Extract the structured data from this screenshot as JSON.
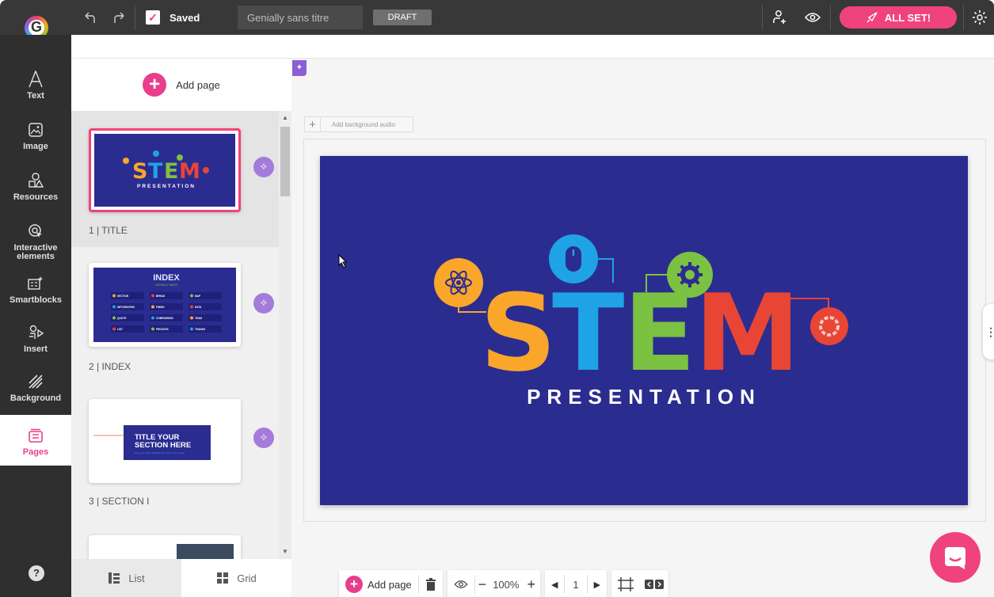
{
  "topbar": {
    "logo_letter": "G",
    "saved_label": "Saved",
    "title_value": "Genially sans titre",
    "draft_label": "DRAFT",
    "all_set_label": "ALL SET!"
  },
  "tools": [
    {
      "label": "Text"
    },
    {
      "label": "Image"
    },
    {
      "label": "Resources"
    },
    {
      "label": "Interactive elements"
    },
    {
      "label": "Smartblocks"
    },
    {
      "label": "Insert"
    },
    {
      "label": "Background"
    },
    {
      "label": "Pages"
    }
  ],
  "pages_panel": {
    "add_page_label": "Add page",
    "pages": [
      {
        "label": "1 | TITLE"
      },
      {
        "label": "2 | INDEX"
      },
      {
        "label": "3 | SECTION I"
      }
    ],
    "list_label": "List",
    "grid_label": "Grid"
  },
  "thumb1": {
    "stem": "STEM",
    "presentation": "PRESENTATION"
  },
  "thumb2": {
    "title": "INDEX",
    "subtitle": "GENIALLY MARS",
    "items": [
      "SECTION",
      "BREAK",
      "MAP",
      "INFOGRAPHIC",
      "FINISH",
      "DATA",
      "QUOTE",
      "COMPARISON",
      "TEAM",
      "LIST",
      "PROCESS",
      "THANKS"
    ]
  },
  "thumb3": {
    "title_line1": "TITLE YOUR",
    "title_line2": "SECTION HERE",
    "subtitle": "Here you could describe the topic of the section"
  },
  "canvas": {
    "bg_audio_label": "Add background audio"
  },
  "slide": {
    "letters": [
      "S",
      "T",
      "E",
      "M"
    ],
    "subtitle": "PRESENTATION",
    "colors": {
      "S": "#f9a62b",
      "T": "#1fa2e6",
      "E": "#7cc242",
      "M": "#e84535",
      "bg": "#2b2c90"
    }
  },
  "bottombar": {
    "add_page_label": "Add page",
    "zoom": "100%",
    "page_number": "1"
  }
}
